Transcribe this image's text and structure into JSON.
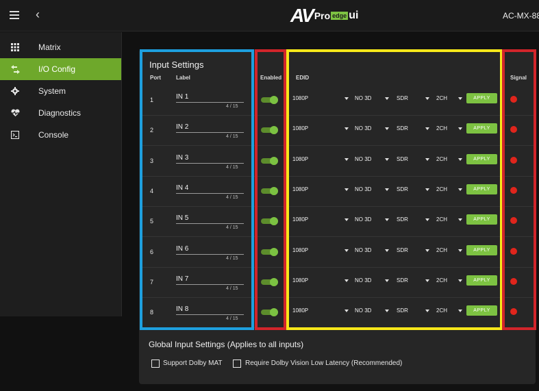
{
  "header": {
    "logo_av": "AV",
    "logo_pro": "Pro",
    "logo_edge": "edge",
    "logo_ui": "ui",
    "device": "AC-MX-88"
  },
  "sidebar": {
    "items": [
      {
        "label": "Matrix",
        "icon": "grid-icon",
        "active": false
      },
      {
        "label": "I/O Config",
        "icon": "swap-arrows-icon",
        "active": true
      },
      {
        "label": "System",
        "icon": "gear-icon",
        "active": false
      },
      {
        "label": "Diagnostics",
        "icon": "heart-pulse-icon",
        "active": false
      },
      {
        "label": "Console",
        "icon": "terminal-icon",
        "active": false
      }
    ]
  },
  "input_settings": {
    "title": "Input Settings",
    "headers": {
      "port": "Port",
      "label": "Label",
      "enabled": "Enabled",
      "edid": "EDID",
      "signal": "Signal"
    },
    "rows": [
      {
        "port": "1",
        "label": "IN 1",
        "count": "4 / 15",
        "enabled": true,
        "edid": "1080P",
        "three_d": "NO 3D",
        "hdr": "SDR",
        "channels": "2CH",
        "apply": "APPLY"
      },
      {
        "port": "2",
        "label": "IN 2",
        "count": "4 / 15",
        "enabled": true,
        "edid": "1080P",
        "three_d": "NO 3D",
        "hdr": "SDR",
        "channels": "2CH",
        "apply": "APPLY"
      },
      {
        "port": "3",
        "label": "IN 3",
        "count": "4 / 15",
        "enabled": true,
        "edid": "1080P",
        "three_d": "NO 3D",
        "hdr": "SDR",
        "channels": "2CH",
        "apply": "APPLY"
      },
      {
        "port": "4",
        "label": "IN 4",
        "count": "4 / 15",
        "enabled": true,
        "edid": "1080P",
        "three_d": "NO 3D",
        "hdr": "SDR",
        "channels": "2CH",
        "apply": "APPLY"
      },
      {
        "port": "5",
        "label": "IN 5",
        "count": "4 / 15",
        "enabled": true,
        "edid": "1080P",
        "three_d": "NO 3D",
        "hdr": "SDR",
        "channels": "2CH",
        "apply": "APPLY"
      },
      {
        "port": "6",
        "label": "IN 6",
        "count": "4 / 15",
        "enabled": true,
        "edid": "1080P",
        "three_d": "NO 3D",
        "hdr": "SDR",
        "channels": "2CH",
        "apply": "APPLY"
      },
      {
        "port": "7",
        "label": "IN 7",
        "count": "4 / 15",
        "enabled": true,
        "edid": "1080P",
        "three_d": "NO 3D",
        "hdr": "SDR",
        "channels": "2CH",
        "apply": "APPLY"
      },
      {
        "port": "8",
        "label": "IN 8",
        "count": "4 / 15",
        "enabled": true,
        "edid": "1080P",
        "three_d": "NO 3D",
        "hdr": "SDR",
        "channels": "2CH",
        "apply": "APPLY"
      }
    ]
  },
  "global_settings": {
    "title": "Global Input Settings (Applies to all inputs)",
    "options": [
      {
        "label": "Support Dolby MAT",
        "checked": false
      },
      {
        "label": "Require Dolby Vision Low Latency (Recommended)",
        "checked": false
      }
    ]
  },
  "colors": {
    "accent": "#7dc242",
    "signal_off": "#e0251c",
    "outline_blue": "#1ea0df",
    "outline_red": "#d2252b",
    "outline_yellow": "#f7e81a"
  }
}
